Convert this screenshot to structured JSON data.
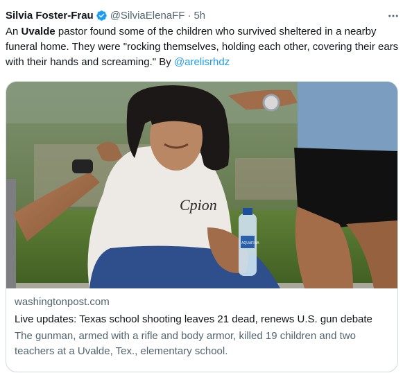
{
  "tweet": {
    "author_name": "Silvia Foster-Frau",
    "author_handle": "@SilviaElenaFF",
    "separator": "·",
    "timestamp": "5h",
    "text_part1": "An ",
    "text_bold": "Uvalde",
    "text_part2": " pastor found some of the children who survived sheltered in a nearby funeral home. They were \"rocking themselves, holding each other, covering their ears with their hands and screaming.\" By ",
    "mention": "@arelisrhdz"
  },
  "card": {
    "domain": "washingtonpost.com",
    "title": "Live updates: Texas school shooting leaves 21 dead, renews U.S. gun debate",
    "description": "The gunman, armed with a rifle and body armor, killed 19 children and two teachers at a Uvalde, Tex., elementary school.",
    "shirt_text": "Cpion",
    "bottle_label": "AQUAFINA"
  },
  "icons": {
    "verified": "verified-badge-icon",
    "more": "more-options-icon"
  },
  "colors": {
    "link": "#1d9bf0",
    "secondary_text": "#536471",
    "verified": "#1d9bf0",
    "border": "#cfd9de"
  }
}
